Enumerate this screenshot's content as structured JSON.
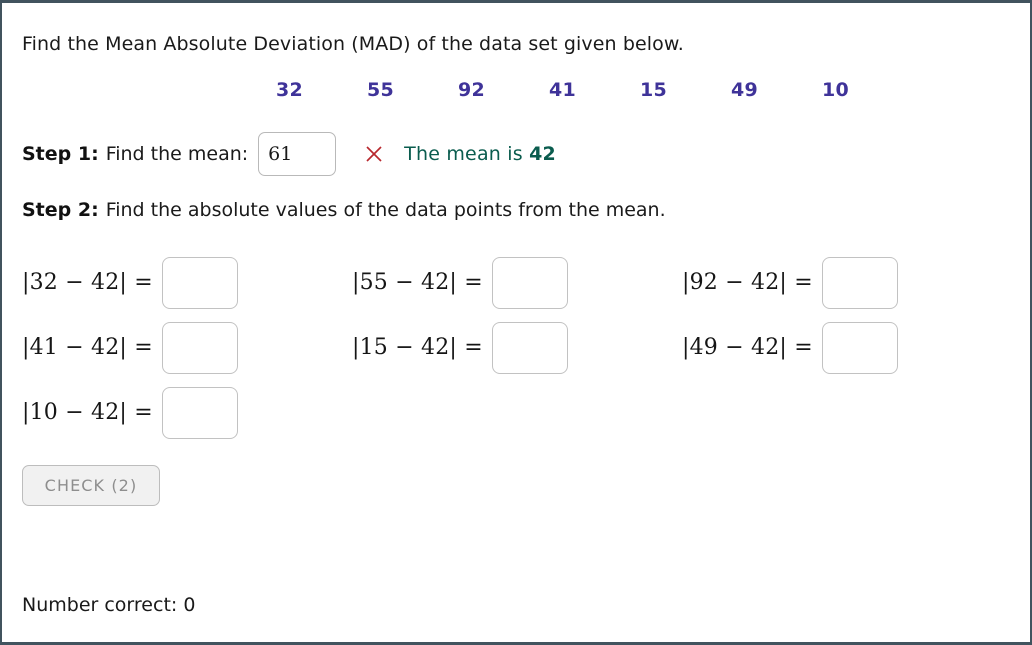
{
  "page": {
    "border_color": "#41535e",
    "background": "#ffffff"
  },
  "prompt": "Find the Mean Absolute Deviation (MAD) of the data set given below.",
  "data_set": {
    "color": "#3f3399",
    "values": [
      "32",
      "55",
      "92",
      "41",
      "15",
      "49",
      "10"
    ]
  },
  "step1": {
    "label": "Step 1:",
    "text": "Find the mean:",
    "input_value": "61",
    "input_placeholder": "",
    "status_icon": "cross-icon",
    "status_icon_color": "#b8282e",
    "feedback_prefix": "The mean is ",
    "feedback_value": "42",
    "feedback_color": "#0a5c4e"
  },
  "step2": {
    "label": "Step 2:",
    "text": "Find the absolute values of the data points from the mean."
  },
  "expressions": [
    [
      {
        "expr": "|32 − 42| =",
        "value": "",
        "placeholder": ""
      },
      {
        "expr": "|55 − 42| =",
        "value": "",
        "placeholder": ""
      },
      {
        "expr": "|92 − 42| =",
        "value": "",
        "placeholder": ""
      }
    ],
    [
      {
        "expr": "|41 − 42| =",
        "value": "",
        "placeholder": ""
      },
      {
        "expr": "|15 − 42| =",
        "value": "",
        "placeholder": ""
      },
      {
        "expr": "|49 − 42| =",
        "value": "",
        "placeholder": ""
      }
    ],
    [
      {
        "expr": "|10 − 42| =",
        "value": "",
        "placeholder": ""
      }
    ]
  ],
  "check_button": {
    "label": "CHECK (2)",
    "disabled_look": true
  },
  "footer": {
    "text": "Number correct: 0"
  }
}
